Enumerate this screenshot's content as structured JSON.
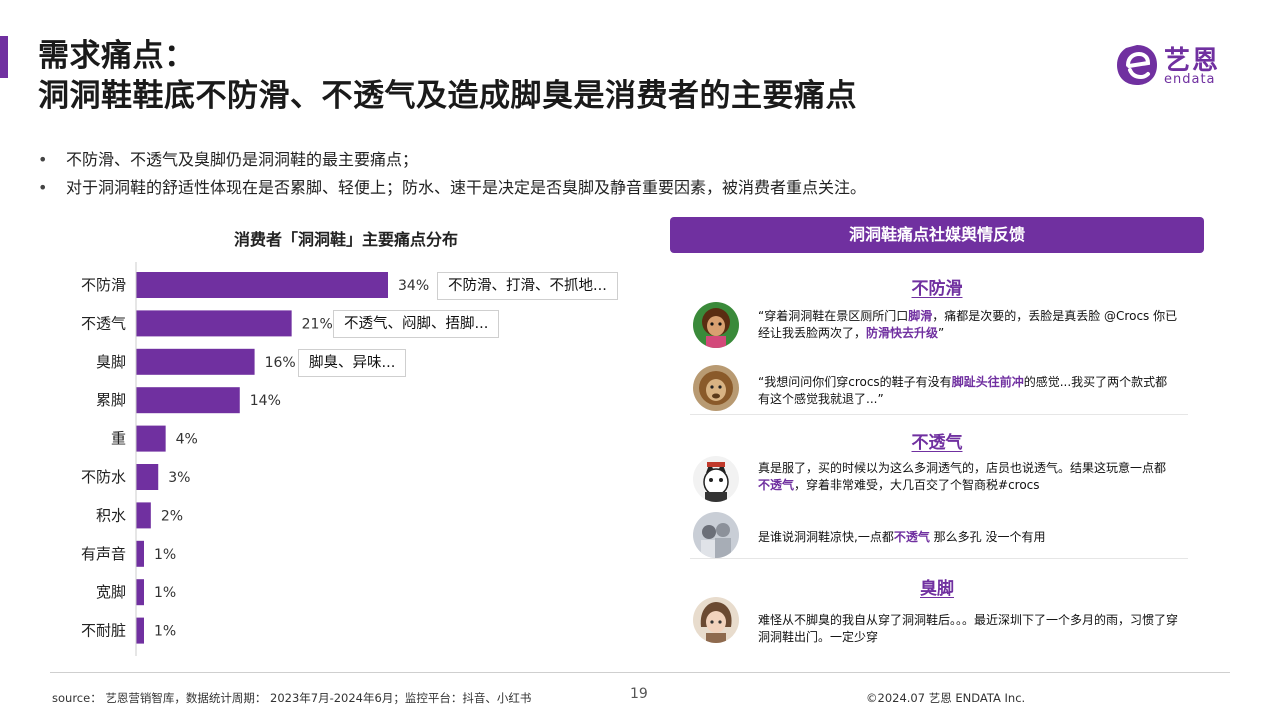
{
  "header": {
    "title_line1": "需求痛点：",
    "title_line2": "洞洞鞋鞋底不防滑、不透气及造成脚臭是消费者的主要痛点",
    "logo_cn": "艺恩",
    "logo_en": "endata"
  },
  "bullets": [
    "不防滑、不透气及臭脚仍是洞洞鞋的最主要痛点；",
    "对于洞洞鞋的舒适性体现在是否累脚、轻便上；防水、速干是决定是否臭脚及静音重要因素，被消费者重点关注。"
  ],
  "chart_data": {
    "type": "bar",
    "orientation": "horizontal",
    "title": "消费者「洞洞鞋」主要痛点分布",
    "categories": [
      "不防滑",
      "不透气",
      "臭脚",
      "累脚",
      "重",
      "不防水",
      "积水",
      "有声音",
      "宽脚",
      "不耐脏"
    ],
    "values": [
      34,
      21,
      16,
      14,
      4,
      3,
      2,
      1,
      1,
      1
    ],
    "value_labels": [
      "34%",
      "21%",
      "16%",
      "14%",
      "4%",
      "3%",
      "2%",
      "1%",
      "1%",
      "1%"
    ],
    "annotations": [
      {
        "category": "不防滑",
        "text": "不防滑、打滑、不抓地..."
      },
      {
        "category": "不透气",
        "text": "不透气、闷脚、捂脚..."
      },
      {
        "category": "臭脚",
        "text": "脚臭、异味..."
      }
    ],
    "xlim": [
      0,
      34
    ],
    "bar_color": "#7030a0",
    "grid": false
  },
  "panel": {
    "header": "洞洞鞋痛点社媒舆情反馈",
    "sections": [
      {
        "title": "不防滑",
        "posts": [
          {
            "avatar": "cartoon-girl",
            "parts": [
              [
                "“穿着洞洞鞋在景区厕所门口",
                false
              ],
              [
                "脚滑",
                true
              ],
              [
                "，痛都是次要的，丢脸是真丢脸 @Crocs 你已经让我丢脸两次了，",
                false
              ],
              [
                "防滑快去升级",
                true
              ],
              [
                "”",
                false
              ]
            ]
          },
          {
            "avatar": "lion",
            "parts": [
              [
                "“我想问问你们穿crocs的鞋子有没有",
                false
              ],
              [
                "脚趾头往前冲",
                true
              ],
              [
                "的感觉...我买了两个款式都有这个感觉我就退了...”",
                false
              ]
            ]
          }
        ]
      },
      {
        "title": "不透气",
        "posts": [
          {
            "avatar": "cat",
            "parts": [
              [
                "真是服了，买的时候以为这么多洞透气的，店员也说透气。结果这玩意一点都",
                false
              ],
              [
                "不透气",
                true
              ],
              [
                "，穿着非常难受，大几百交了个智商税#crocs",
                false
              ]
            ]
          },
          {
            "avatar": "photo-people",
            "parts": [
              [
                "是谁说洞洞鞋凉快,一点都",
                false
              ],
              [
                "不透气",
                true
              ],
              [
                " 那么多孔 没一个有用",
                false
              ]
            ]
          }
        ]
      },
      {
        "title": "臭脚",
        "posts": [
          {
            "avatar": "anime-girl",
            "parts": [
              [
                "难怪从不脚臭的我自从穿了洞洞鞋后。。。最近深圳下了一个多月的雨，习惯了穿洞洞鞋出门。一定少穿",
                false
              ]
            ]
          }
        ]
      }
    ]
  },
  "footer": {
    "source": "source： 艺恩营销智库，数据统计周期： 2023年7月-2024年6月；监控平台：抖音、小红书",
    "page": "19",
    "copyright": "©2024.07 艺恩 ENDATA Inc."
  },
  "colors": {
    "accent": "#7030a0"
  }
}
